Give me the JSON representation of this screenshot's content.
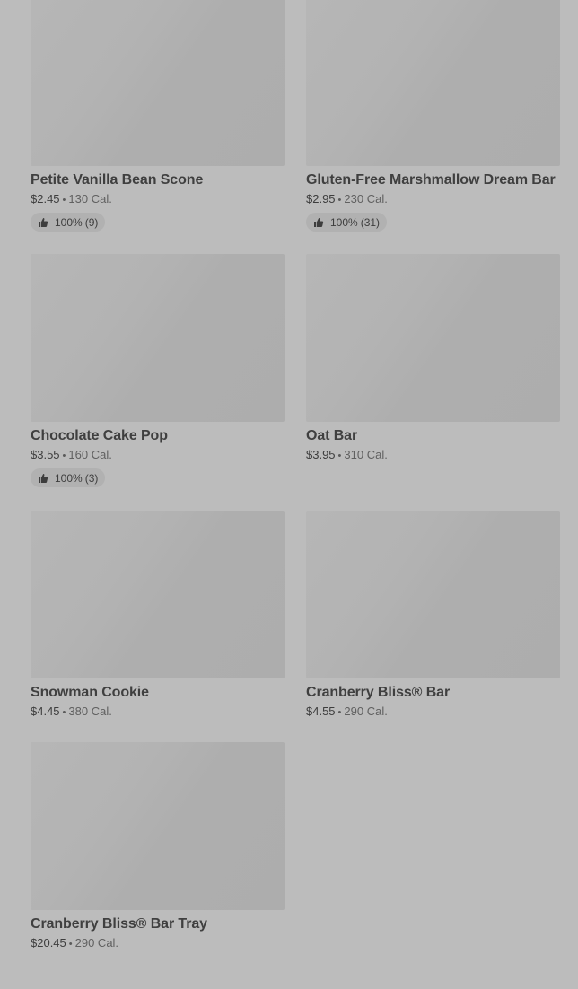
{
  "products": [
    {
      "name": "Petite Vanilla Bean Scone",
      "price": "$2.45",
      "separator": "•",
      "calories": "130 Cal.",
      "rating_percent": "100%",
      "rating_count": "(9)"
    },
    {
      "name": "Gluten-Free Marshmallow Dream Bar",
      "price": "$2.95",
      "separator": "•",
      "calories": "230 Cal.",
      "rating_percent": "100%",
      "rating_count": "(31)"
    },
    {
      "name": "Chocolate Cake Pop",
      "price": "$3.55",
      "separator": "•",
      "calories": "160 Cal.",
      "rating_percent": "100%",
      "rating_count": "(3)"
    },
    {
      "name": "Oat Bar",
      "price": "$3.95",
      "separator": "•",
      "calories": "310 Cal."
    },
    {
      "name": "Snowman Cookie",
      "price": "$4.45",
      "separator": "•",
      "calories": "380 Cal."
    },
    {
      "name": "Cranberry Bliss® Bar",
      "price": "$4.55",
      "separator": "•",
      "calories": "290 Cal."
    },
    {
      "name": "Cranberry Bliss® Bar Tray",
      "price": "$20.45",
      "separator": "•",
      "calories": "290 Cal."
    }
  ],
  "icons": {
    "rating": "thumbs-up-icon"
  }
}
